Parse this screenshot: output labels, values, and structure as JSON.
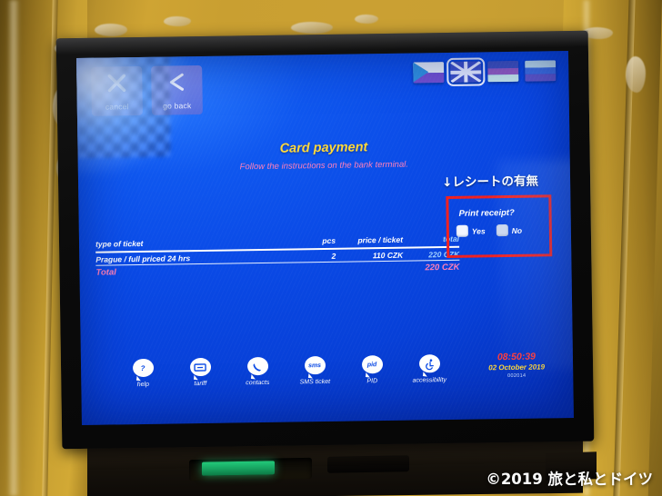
{
  "kiosk": {
    "reader_label": "card-reader-slot"
  },
  "nav": {
    "cancel": {
      "label": "cancel",
      "icon": "close-x-icon"
    },
    "go_back": {
      "label": "go back",
      "icon": "arrow-left-icon"
    }
  },
  "languages": [
    {
      "name": "czech-flag",
      "code": "cz",
      "selected": false
    },
    {
      "name": "uk-flag",
      "code": "en",
      "selected": true
    },
    {
      "name": "german-flag",
      "code": "de",
      "selected": false
    },
    {
      "name": "russian-flag",
      "code": "ru",
      "selected": false
    }
  ],
  "screen": {
    "title": "Card payment",
    "subtitle": "Follow the instructions on the bank terminal."
  },
  "ticket_table": {
    "headers": {
      "type": "type of ticket",
      "pcs": "pcs",
      "price": "price / ticket",
      "total": "total"
    },
    "rows": [
      {
        "type": "Prague / full priced 24 hrs",
        "pcs": "2",
        "price": "110 CZK",
        "total": "220 CZK"
      }
    ],
    "total_label": "Total",
    "total_value": "220 CZK"
  },
  "receipt": {
    "annotation": "↓レシートの有無",
    "question": "Print receipt?",
    "yes_label": "Yes",
    "no_label": "No"
  },
  "help_bar": [
    {
      "icon": "question-mark-icon",
      "glyph": "?",
      "label": "help"
    },
    {
      "icon": "tariff-icon",
      "glyph": "⊞",
      "label": "tariff"
    },
    {
      "icon": "phone-icon",
      "glyph": "✆",
      "label": "contacts"
    },
    {
      "icon": "sms-icon",
      "glyph": "sms",
      "label": "SMS ticket"
    },
    {
      "icon": "pid-icon",
      "glyph": "pid",
      "label": "PID"
    },
    {
      "icon": "wheelchair-icon",
      "glyph": "♿",
      "label": "accessibility"
    }
  ],
  "clock": {
    "time": "08:50:39",
    "date": "02 October 2019",
    "machine_id": "002014"
  },
  "watermark": "©2019 旅と私とドイツ",
  "colors": {
    "screen_blue": "#0a4ae6",
    "title_yellow": "#ffd83a",
    "subtitle_pink": "#ff7fb8",
    "total_pink": "#ff7fb8",
    "value_lightblue": "#9fd0ff",
    "highlight_red": "#ef2020",
    "clock_red": "#ff3b3b",
    "kiosk_yellow": "#caa033",
    "led_green": "#24d07e"
  }
}
